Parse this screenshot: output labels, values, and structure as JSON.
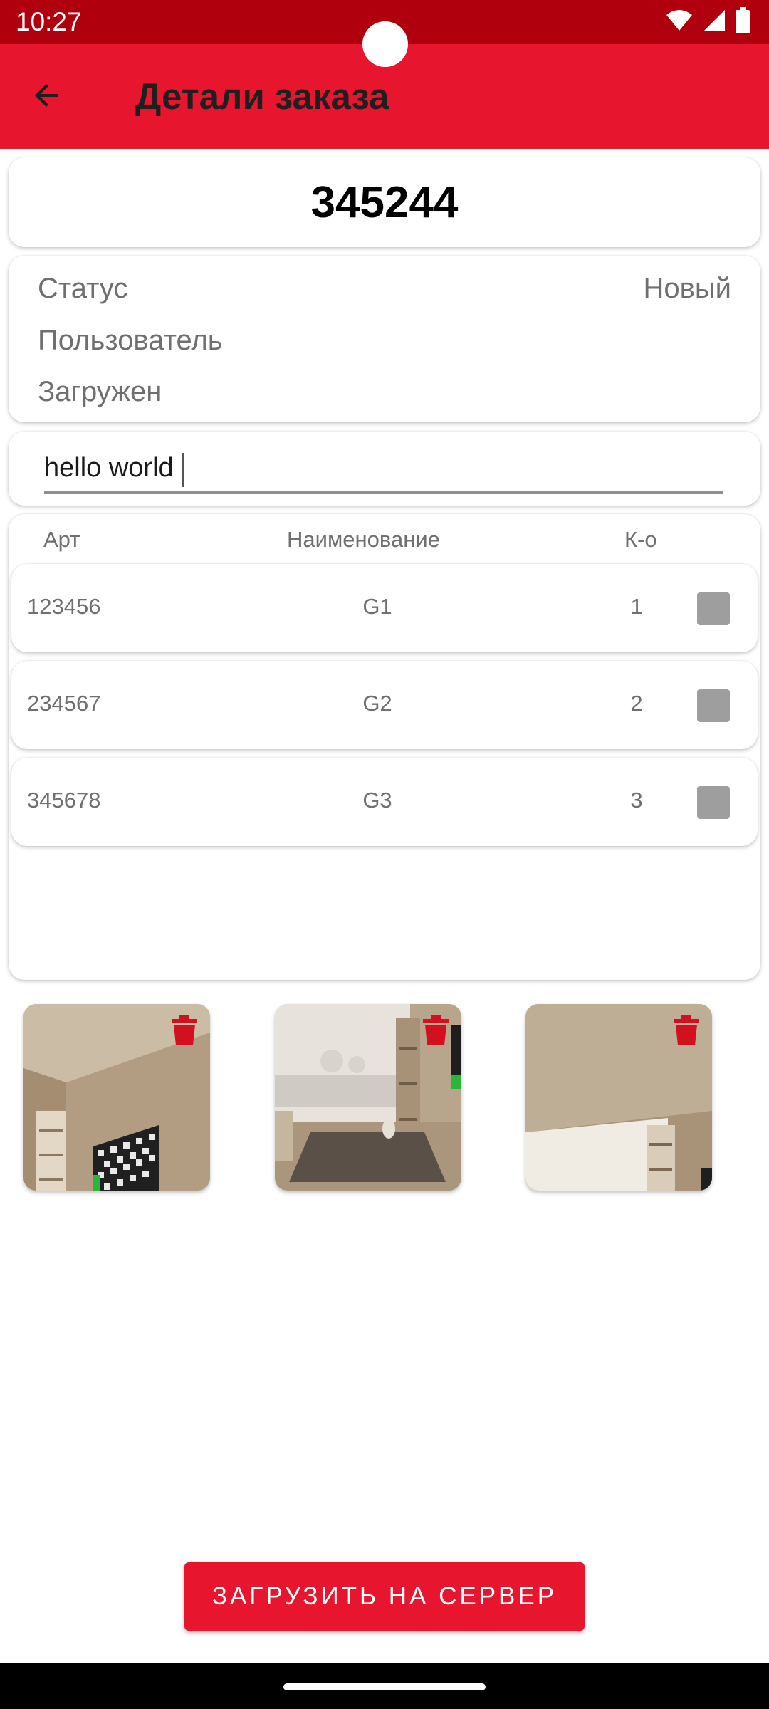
{
  "status_bar": {
    "time": "10:27",
    "icons": [
      "wifi-icon",
      "signal-icon",
      "battery-icon"
    ]
  },
  "app_bar": {
    "title": "Детали заказа",
    "back_icon": "arrow-back-icon"
  },
  "order": {
    "number": "345244"
  },
  "info": {
    "status_label": "Статус",
    "status_value": "Новый",
    "user_label": "Пользователь",
    "user_value": "",
    "loaded_label": "Загружен",
    "loaded_value": ""
  },
  "comment": {
    "value": "hello world",
    "placeholder": ""
  },
  "items": {
    "headers": {
      "art": "Арт",
      "name": "Наименование",
      "qty": "К-о"
    },
    "rows": [
      {
        "art": "123456",
        "name": "G1",
        "qty": "1",
        "checked": true
      },
      {
        "art": "234567",
        "name": "G2",
        "qty": "2",
        "checked": true
      },
      {
        "art": "345678",
        "name": "G3",
        "qty": "3",
        "checked": true
      }
    ]
  },
  "photos": [
    {
      "scene": "room-corner-with-checkerboard",
      "delete_icon": "trash-icon"
    },
    {
      "scene": "room-window-with-rug",
      "delete_icon": "trash-icon"
    },
    {
      "scene": "room-ceiling-with-window",
      "delete_icon": "trash-icon"
    }
  ],
  "actions": {
    "upload_label": "ЗАГРУЗИТЬ НА СЕРВЕР"
  },
  "colors": {
    "status_bar": "#b0000e",
    "app_bar": "#e8152f",
    "accent": "#e8152f",
    "delete_icon": "#d3101f",
    "checkbox": "#9e9e9e"
  }
}
